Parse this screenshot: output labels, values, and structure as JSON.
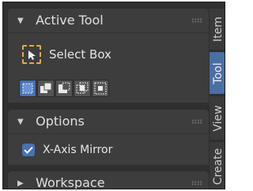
{
  "panels": {
    "active_tool": {
      "title": "Active Tool",
      "tool_name": "Select Box",
      "modes": [
        "mode-set",
        "mode-extend",
        "mode-subtract",
        "mode-intersect",
        "mode-difference"
      ]
    },
    "options": {
      "title": "Options",
      "x_axis_mirror": {
        "label": "X-Axis Mirror",
        "checked": true
      }
    },
    "workspace": {
      "title": "Workspace"
    }
  },
  "tabs": [
    "Item",
    "Tool",
    "View",
    "Create"
  ],
  "active_tab": "Tool",
  "colors": {
    "background": "#2f2f2f",
    "panel": "#3d3d3d",
    "accent": "#4772b3",
    "tool_icon": "#e0a94c",
    "text": "#e6e6e6"
  },
  "icons": {
    "expanded": "▼",
    "collapsed": "▶"
  }
}
